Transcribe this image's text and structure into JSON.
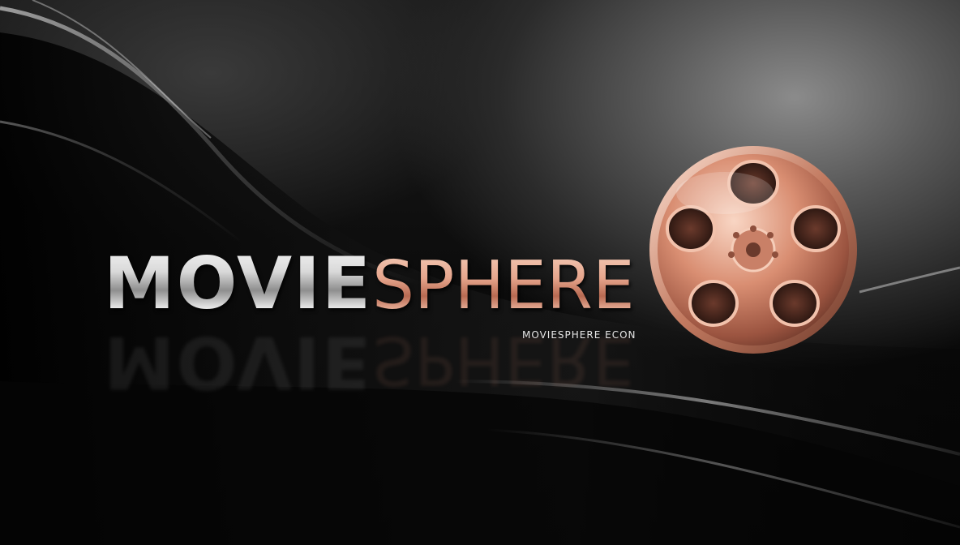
{
  "brand": {
    "name_part1": "MOVIE",
    "name_part2": "SPHERE",
    "tagline": "MOVIESPHERE ECON"
  },
  "icons": {
    "reel": "film-reel-icon"
  },
  "colors": {
    "background": "#070707",
    "silver": "#d9d9d9",
    "copper": "#e6a58c"
  }
}
